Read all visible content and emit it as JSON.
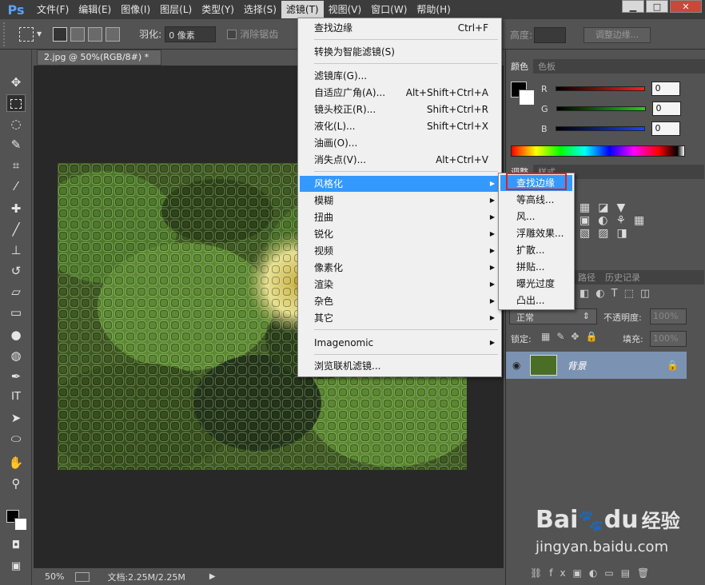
{
  "app": {
    "logo": "Ps"
  },
  "menubar": {
    "items": [
      "文件(F)",
      "编辑(E)",
      "图像(I)",
      "图层(L)",
      "类型(Y)",
      "选择(S)",
      "滤镜(T)",
      "视图(V)",
      "窗口(W)",
      "帮助(H)"
    ],
    "active_index": 6
  },
  "window_controls": {
    "minimize": "▁",
    "maximize": "□",
    "close": "✕"
  },
  "options_bar": {
    "feather_label": "羽化:",
    "feather_value": "0 像素",
    "antialias_label": "消除锯齿",
    "height_label": "高度:",
    "refine_edge_button": "调整边缘..."
  },
  "document": {
    "tab_title": "2.jpg @ 50%(RGB/8#) *",
    "tab_close": "×",
    "zoom": "50%",
    "doc_info": "文档:2.25M/2.25M"
  },
  "color_panel": {
    "tabs": [
      "颜色",
      "色板"
    ],
    "active_tab": 0,
    "channels": [
      {
        "label": "R",
        "value": "0",
        "color": "#ff2020"
      },
      {
        "label": "G",
        "value": "0",
        "color": "#20d020"
      },
      {
        "label": "B",
        "value": "0",
        "color": "#2040ff"
      }
    ]
  },
  "adjust_panel": {
    "tabs": [
      "调整",
      "样式"
    ]
  },
  "layers_panel": {
    "tabs": [
      "路径",
      "历史记录"
    ],
    "blend_mode": "正常",
    "opacity_label": "不透明度:",
    "opacity_value": "100%",
    "lock_label": "锁定:",
    "fill_label": "填充:",
    "fill_value": "100%",
    "layer_name": "背景"
  },
  "filter_menu": {
    "items": [
      {
        "label": "查找边缘",
        "shortcut": "Ctrl+F"
      },
      {
        "label": "转换为智能滤镜(S)",
        "shortcut": ""
      },
      {
        "label": "滤镜库(G)...",
        "shortcut": ""
      },
      {
        "label": "自适应广角(A)...",
        "shortcut": "Alt+Shift+Ctrl+A"
      },
      {
        "label": "镜头校正(R)...",
        "shortcut": "Shift+Ctrl+R"
      },
      {
        "label": "液化(L)...",
        "shortcut": "Shift+Ctrl+X"
      },
      {
        "label": "油画(O)...",
        "shortcut": ""
      },
      {
        "label": "消失点(V)...",
        "shortcut": "Alt+Ctrl+V"
      },
      {
        "label": "风格化",
        "shortcut": ""
      },
      {
        "label": "模糊",
        "shortcut": ""
      },
      {
        "label": "扭曲",
        "shortcut": ""
      },
      {
        "label": "锐化",
        "shortcut": ""
      },
      {
        "label": "视频",
        "shortcut": ""
      },
      {
        "label": "像素化",
        "shortcut": ""
      },
      {
        "label": "渲染",
        "shortcut": ""
      },
      {
        "label": "杂色",
        "shortcut": ""
      },
      {
        "label": "其它",
        "shortcut": ""
      },
      {
        "label": "Imagenomic",
        "shortcut": ""
      },
      {
        "label": "浏览联机滤镜...",
        "shortcut": ""
      }
    ],
    "highlighted": "风格化"
  },
  "stylize_submenu": {
    "items": [
      "查找边缘",
      "等高线...",
      "风...",
      "浮雕效果...",
      "扩散...",
      "拼贴...",
      "曝光过度",
      "凸出..."
    ],
    "highlighted": "查找边缘"
  },
  "watermark": {
    "brand": "Bai",
    "brand2": "du",
    "brand_cn": "经验",
    "url": "jingyan.baidu.com"
  },
  "colors": {
    "menu_highlight": "#3399ff",
    "callout_box": "#e02020",
    "layer_selected": "#7b92b2"
  }
}
